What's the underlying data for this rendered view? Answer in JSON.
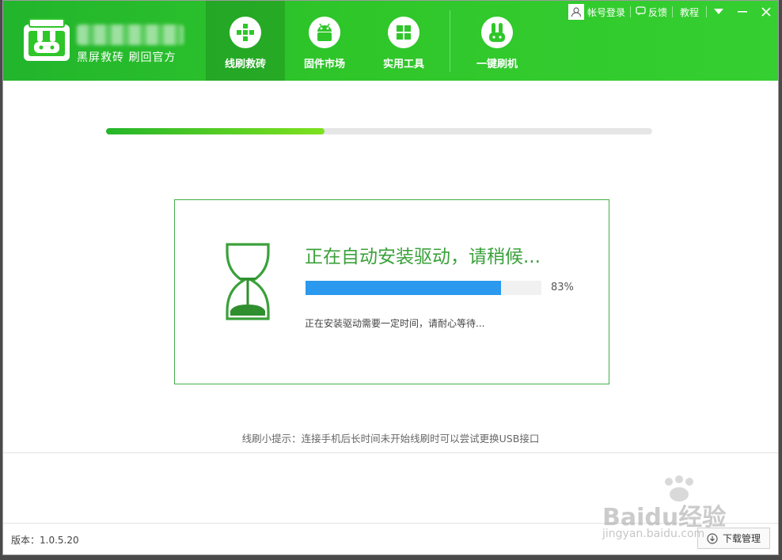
{
  "app": {
    "brand_tagline": "黑屏救砖 刷回官方"
  },
  "nav": {
    "tabs": [
      {
        "label": "线刷救砖",
        "icon": "plus-icon",
        "active": true
      },
      {
        "label": "固件市场",
        "icon": "android-icon",
        "active": false
      },
      {
        "label": "实用工具",
        "icon": "grid-icon",
        "active": false
      },
      {
        "label": "一键刷机",
        "icon": "rabbit-icon",
        "active": false
      }
    ]
  },
  "topbar": {
    "login_label": "帐号登录",
    "feedback_label": "反馈",
    "tutorial_label": "教程"
  },
  "overall_progress": {
    "fraction": 0.4
  },
  "card": {
    "title": "正在自动安装驱动，请稍候...",
    "progress_percent": 83,
    "progress_text": "83%",
    "subtitle": "正在安装驱动需要一定时间，请耐心等待..."
  },
  "tip": "线刷小提示：连接手机后长时间未开始线刷时可以尝试更换USB接口",
  "footer": {
    "version": "版本：1.0.5.20",
    "download_manager_label": "下载管理"
  },
  "watermark": {
    "text": "Baidu经验",
    "url": "jingyan.baidu.com"
  },
  "colors": {
    "header_green": "#2fc62a",
    "accent_green": "#3aa13b",
    "progress_blue": "#2a99ee"
  }
}
